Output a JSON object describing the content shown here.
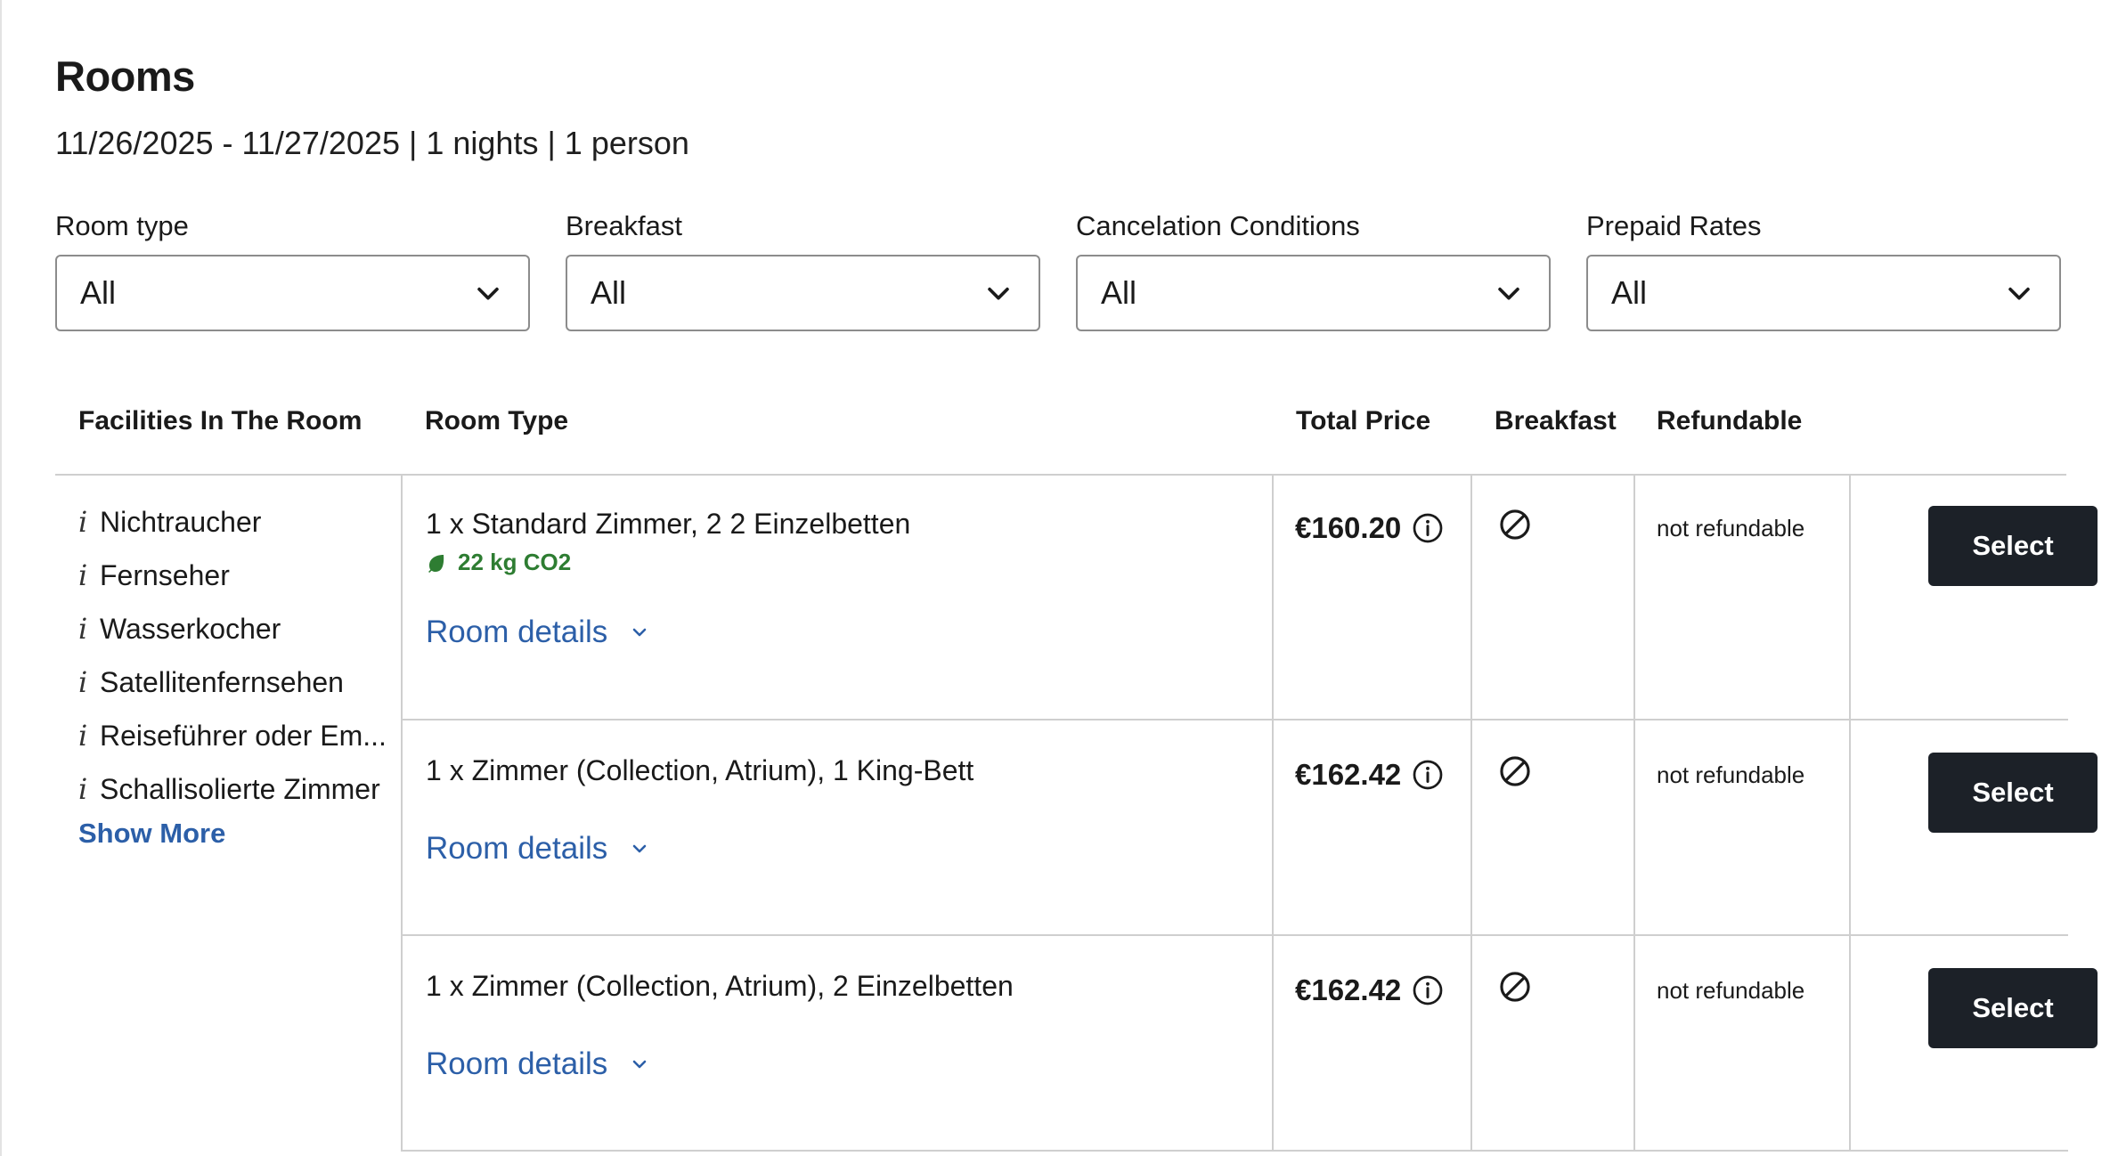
{
  "page": {
    "title": "Rooms",
    "subtitle": "11/26/2025 - 11/27/2025 | 1 nights | 1 person"
  },
  "filters": [
    {
      "label": "Room type",
      "value": "All"
    },
    {
      "label": "Breakfast",
      "value": "All"
    },
    {
      "label": "Cancelation Conditions",
      "value": "All"
    },
    {
      "label": "Prepaid Rates",
      "value": "All"
    }
  ],
  "table": {
    "headers": {
      "facilities": "Facilities In The Room",
      "room_type": "Room Type",
      "total_price": "Total Price",
      "breakfast": "Breakfast",
      "refundable": "Refundable"
    },
    "facilities": [
      "Nichtraucher",
      "Fernseher",
      "Wasserkocher",
      "Satellitenfernsehen",
      "Reiseführer oder Em...",
      "Schallisolierte Zimmer"
    ],
    "facility_icon": "i",
    "show_more": "Show More",
    "rows": [
      {
        "room_name": "1 x Standard Zimmer, 2 2 Einzelbetten",
        "co2": "22 kg CO2",
        "details_label": "Room details",
        "price": "€160.20",
        "breakfast_icon": "no-breakfast-icon",
        "refundable": "not refundable",
        "button": "Select"
      },
      {
        "room_name": "1 x Zimmer (Collection, Atrium), 1 King-Bett",
        "details_label": "Room details",
        "price": "€162.42",
        "breakfast_icon": "no-breakfast-icon",
        "refundable": "not refundable",
        "button": "Select"
      },
      {
        "room_name": "1 x Zimmer (Collection, Atrium), 2 Einzelbetten",
        "details_label": "Room details",
        "price": "€162.42",
        "breakfast_icon": "no-breakfast-icon",
        "refundable": "not refundable",
        "button": "Select"
      }
    ]
  },
  "colors": {
    "link": "#2c5fa8",
    "co2_green": "#2e7d32",
    "button_bg": "#1c2128",
    "border": "#cfcfcf"
  }
}
